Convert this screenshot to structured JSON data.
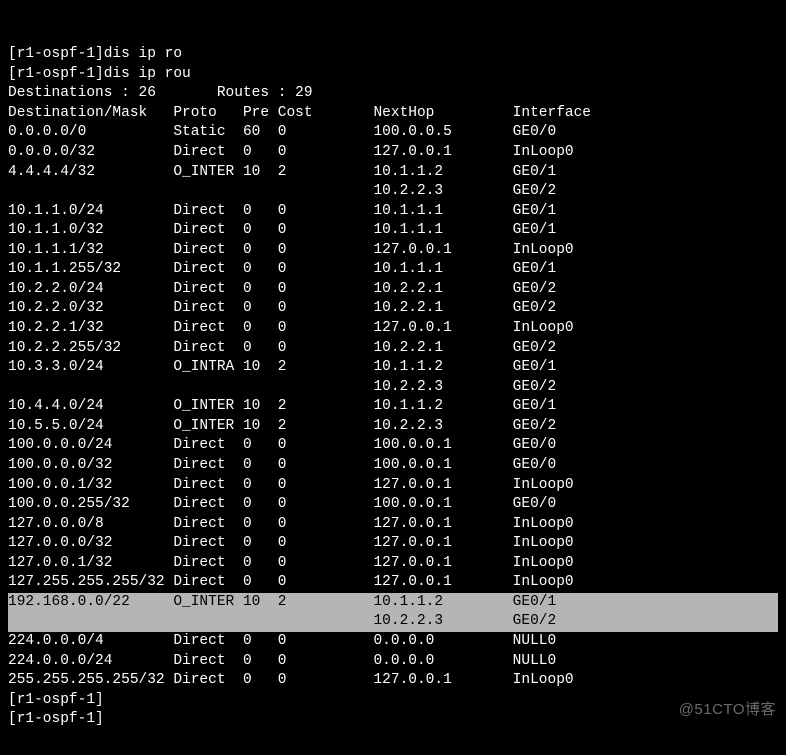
{
  "prompt_lines": [
    "[r1-ospf-1]dis ip ro",
    "[r1-ospf-1]dis ip rou"
  ],
  "summary": "Destinations : 26       Routes : 29",
  "header": {
    "dest": "Destination/Mask",
    "proto": "Proto",
    "pre": "Pre",
    "cost": "Cost",
    "nexthop": "NextHop",
    "iface": "Interface"
  },
  "rows": [
    {
      "dest": "0.0.0.0/0",
      "proto": "Static",
      "pre": "60",
      "cost": "0",
      "nexthop": "100.0.0.5",
      "iface": "GE0/0"
    },
    {
      "dest": "0.0.0.0/32",
      "proto": "Direct",
      "pre": "0",
      "cost": "0",
      "nexthop": "127.0.0.1",
      "iface": "InLoop0"
    },
    {
      "dest": "4.4.4.4/32",
      "proto": "O_INTER",
      "pre": "10",
      "cost": "2",
      "nexthop": "10.1.1.2",
      "iface": "GE0/1"
    },
    {
      "dest": "",
      "proto": "",
      "pre": "",
      "cost": "",
      "nexthop": "10.2.2.3",
      "iface": "GE0/2"
    },
    {
      "dest": "10.1.1.0/24",
      "proto": "Direct",
      "pre": "0",
      "cost": "0",
      "nexthop": "10.1.1.1",
      "iface": "GE0/1"
    },
    {
      "dest": "10.1.1.0/32",
      "proto": "Direct",
      "pre": "0",
      "cost": "0",
      "nexthop": "10.1.1.1",
      "iface": "GE0/1"
    },
    {
      "dest": "10.1.1.1/32",
      "proto": "Direct",
      "pre": "0",
      "cost": "0",
      "nexthop": "127.0.0.1",
      "iface": "InLoop0"
    },
    {
      "dest": "10.1.1.255/32",
      "proto": "Direct",
      "pre": "0",
      "cost": "0",
      "nexthop": "10.1.1.1",
      "iface": "GE0/1"
    },
    {
      "dest": "10.2.2.0/24",
      "proto": "Direct",
      "pre": "0",
      "cost": "0",
      "nexthop": "10.2.2.1",
      "iface": "GE0/2"
    },
    {
      "dest": "10.2.2.0/32",
      "proto": "Direct",
      "pre": "0",
      "cost": "0",
      "nexthop": "10.2.2.1",
      "iface": "GE0/2"
    },
    {
      "dest": "10.2.2.1/32",
      "proto": "Direct",
      "pre": "0",
      "cost": "0",
      "nexthop": "127.0.0.1",
      "iface": "InLoop0"
    },
    {
      "dest": "10.2.2.255/32",
      "proto": "Direct",
      "pre": "0",
      "cost": "0",
      "nexthop": "10.2.2.1",
      "iface": "GE0/2"
    },
    {
      "dest": "10.3.3.0/24",
      "proto": "O_INTRA",
      "pre": "10",
      "cost": "2",
      "nexthop": "10.1.1.2",
      "iface": "GE0/1"
    },
    {
      "dest": "",
      "proto": "",
      "pre": "",
      "cost": "",
      "nexthop": "10.2.2.3",
      "iface": "GE0/2"
    },
    {
      "dest": "10.4.4.0/24",
      "proto": "O_INTER",
      "pre": "10",
      "cost": "2",
      "nexthop": "10.1.1.2",
      "iface": "GE0/1"
    },
    {
      "dest": "10.5.5.0/24",
      "proto": "O_INTER",
      "pre": "10",
      "cost": "2",
      "nexthop": "10.2.2.3",
      "iface": "GE0/2"
    },
    {
      "dest": "100.0.0.0/24",
      "proto": "Direct",
      "pre": "0",
      "cost": "0",
      "nexthop": "100.0.0.1",
      "iface": "GE0/0"
    },
    {
      "dest": "100.0.0.0/32",
      "proto": "Direct",
      "pre": "0",
      "cost": "0",
      "nexthop": "100.0.0.1",
      "iface": "GE0/0"
    },
    {
      "dest": "100.0.0.1/32",
      "proto": "Direct",
      "pre": "0",
      "cost": "0",
      "nexthop": "127.0.0.1",
      "iface": "InLoop0"
    },
    {
      "dest": "100.0.0.255/32",
      "proto": "Direct",
      "pre": "0",
      "cost": "0",
      "nexthop": "100.0.0.1",
      "iface": "GE0/0"
    },
    {
      "dest": "127.0.0.0/8",
      "proto": "Direct",
      "pre": "0",
      "cost": "0",
      "nexthop": "127.0.0.1",
      "iface": "InLoop0"
    },
    {
      "dest": "127.0.0.0/32",
      "proto": "Direct",
      "pre": "0",
      "cost": "0",
      "nexthop": "127.0.0.1",
      "iface": "InLoop0"
    },
    {
      "dest": "127.0.0.1/32",
      "proto": "Direct",
      "pre": "0",
      "cost": "0",
      "nexthop": "127.0.0.1",
      "iface": "InLoop0"
    },
    {
      "dest": "127.255.255.255/32",
      "proto": "Direct",
      "pre": "0",
      "cost": "0",
      "nexthop": "127.0.0.1",
      "iface": "InLoop0"
    },
    {
      "dest": "192.168.0.0/22",
      "proto": "O_INTER",
      "pre": "10",
      "cost": "2",
      "nexthop": "10.1.1.2",
      "iface": "GE0/1",
      "hl": true
    },
    {
      "dest": "",
      "proto": "",
      "pre": "",
      "cost": "",
      "nexthop": "10.2.2.3",
      "iface": "GE0/2",
      "hl": true
    },
    {
      "dest": "224.0.0.0/4",
      "proto": "Direct",
      "pre": "0",
      "cost": "0",
      "nexthop": "0.0.0.0",
      "iface": "NULL0"
    },
    {
      "dest": "224.0.0.0/24",
      "proto": "Direct",
      "pre": "0",
      "cost": "0",
      "nexthop": "0.0.0.0",
      "iface": "NULL0"
    },
    {
      "dest": "255.255.255.255/32",
      "proto": "Direct",
      "pre": "0",
      "cost": "0",
      "nexthop": "127.0.0.1",
      "iface": "InLoop0"
    }
  ],
  "trailing_prompts": [
    "[r1-ospf-1]",
    "[r1-ospf-1]"
  ],
  "watermark": "@51CTO博客",
  "col_widths": {
    "dest": 19,
    "proto": 8,
    "pre": 4,
    "cost": 11,
    "nexthop": 16
  }
}
